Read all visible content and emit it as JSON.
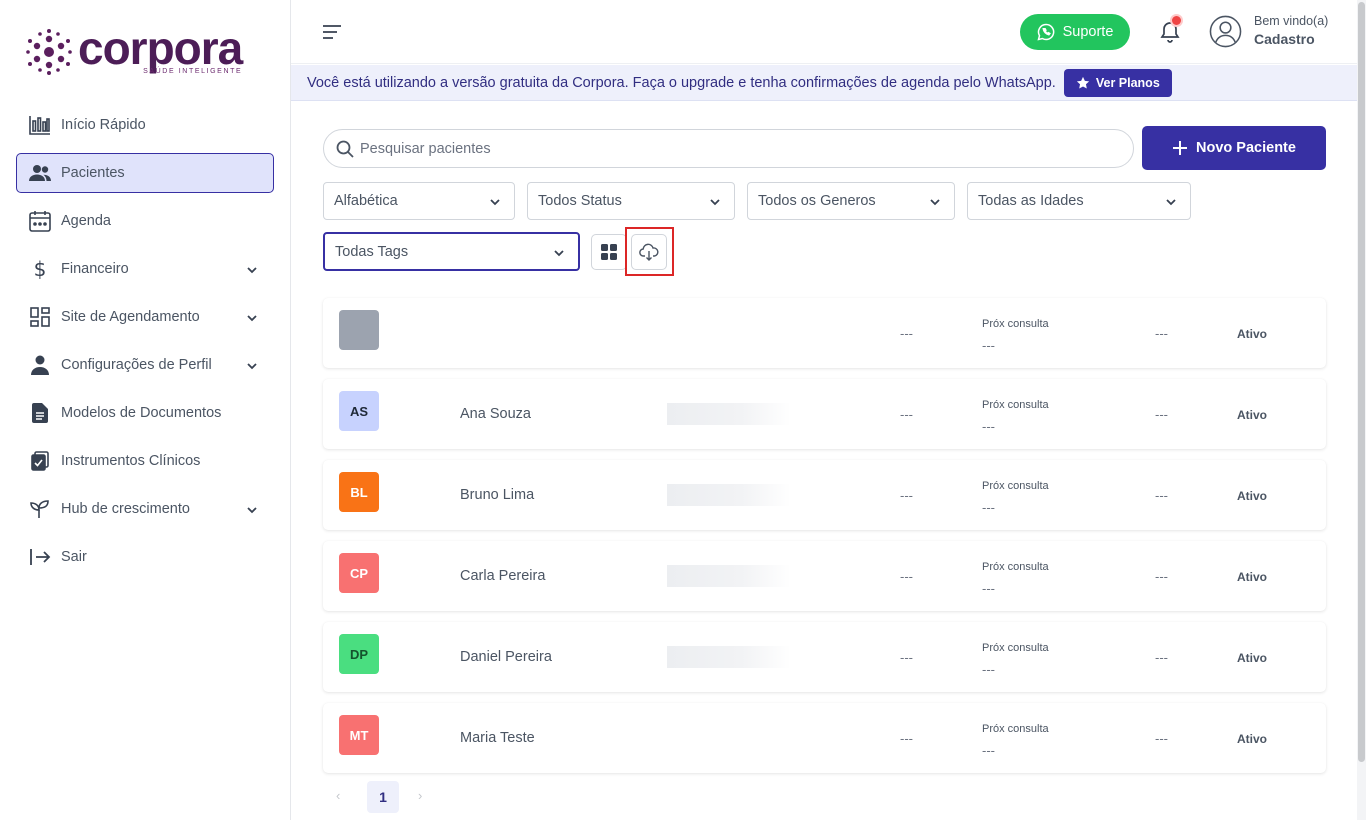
{
  "brand": {
    "name": "corpora",
    "tagline": "SAÚDE INTELIGENTE"
  },
  "sidebar": {
    "items": [
      {
        "label": "Início Rápido",
        "icon": "bar-chart-icon",
        "active": false,
        "expandable": false
      },
      {
        "label": "Pacientes",
        "icon": "users-icon",
        "active": true,
        "expandable": false
      },
      {
        "label": "Agenda",
        "icon": "calendar-icon",
        "active": false,
        "expandable": false
      },
      {
        "label": "Financeiro",
        "icon": "dollar-icon",
        "active": false,
        "expandable": true
      },
      {
        "label": "Site de Agendamento",
        "icon": "layout-icon",
        "active": false,
        "expandable": true
      },
      {
        "label": "Configurações de Perfil",
        "icon": "user-icon",
        "active": false,
        "expandable": true
      },
      {
        "label": "Modelos de Documentos",
        "icon": "document-icon",
        "active": false,
        "expandable": false
      },
      {
        "label": "Instrumentos Clínicos",
        "icon": "clipboard-icon",
        "active": false,
        "expandable": false
      },
      {
        "label": "Hub de crescimento",
        "icon": "sprout-icon",
        "active": false,
        "expandable": true
      },
      {
        "label": "Sair",
        "icon": "logout-icon",
        "active": false,
        "expandable": false
      }
    ]
  },
  "header": {
    "support_label": "Suporte",
    "greeting": "Bem vindo(a)",
    "user_name": "Cadastro",
    "has_notification": true
  },
  "banner": {
    "text": "Você está utilizando a versão gratuita da Corpora. Faça o upgrade e tenha confirmações de agenda pelo WhatsApp.",
    "button_label": "Ver Planos"
  },
  "toolbar": {
    "search_placeholder": "Pesquisar pacientes",
    "new_patient_label": "Novo Paciente",
    "filters": {
      "sort": "Alfabética",
      "status": "Todos Status",
      "gender": "Todos os Generos",
      "age": "Todas as Idades",
      "tags": "Todas Tags"
    }
  },
  "patients": [
    {
      "initials": "",
      "name": "",
      "avatar_bg": "#9ca3af",
      "avatar_fg": "#ffffff",
      "col1": "---",
      "next_label": "Próx consulta",
      "next_value": "---",
      "col2": "---",
      "status": "Ativo",
      "show_blur": false
    },
    {
      "initials": "AS",
      "name": "Ana Souza",
      "avatar_bg": "#c7d2fe",
      "avatar_fg": "#1f2937",
      "col1": "---",
      "next_label": "Próx consulta",
      "next_value": "---",
      "col2": "---",
      "status": "Ativo",
      "show_blur": true
    },
    {
      "initials": "BL",
      "name": "Bruno Lima",
      "avatar_bg": "#f97316",
      "avatar_fg": "#ffffff",
      "col1": "---",
      "next_label": "Próx consulta",
      "next_value": "---",
      "col2": "---",
      "status": "Ativo",
      "show_blur": true
    },
    {
      "initials": "CP",
      "name": "Carla Pereira",
      "avatar_bg": "#f87171",
      "avatar_fg": "#ffffff",
      "col1": "---",
      "next_label": "Próx consulta",
      "next_value": "---",
      "col2": "---",
      "status": "Ativo",
      "show_blur": true
    },
    {
      "initials": "DP",
      "name": "Daniel Pereira",
      "avatar_bg": "#4ade80",
      "avatar_fg": "#14532d",
      "col1": "---",
      "next_label": "Próx consulta",
      "next_value": "---",
      "col2": "---",
      "status": "Ativo",
      "show_blur": true
    },
    {
      "initials": "MT",
      "name": "Maria Teste",
      "avatar_bg": "#f87171",
      "avatar_fg": "#ffffff",
      "col1": "---",
      "next_label": "Próx consulta",
      "next_value": "---",
      "col2": "---",
      "status": "Ativo",
      "show_blur": false
    }
  ],
  "pagination": {
    "current": "1",
    "prev": "‹",
    "next": "›"
  },
  "colors": {
    "primary": "#3730a3",
    "support": "#22c55e",
    "highlight": "#dc2626",
    "brand": "#4c1d57"
  }
}
